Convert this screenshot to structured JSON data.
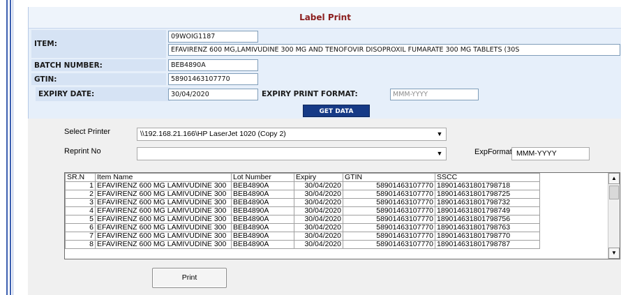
{
  "header": {
    "title": "Label Print"
  },
  "form": {
    "item_label": "ITEM:",
    "item_code": "09WOIG1187",
    "item_description": "EFAVIRENZ 600 MG,LAMIVUDINE 300 MG AND TENOFOVIR DISOPROXIL FUMARATE 300 MG TABLETS (30S",
    "batch_label": "BATCH NUMBER:",
    "batch_value": "BEB4890A",
    "gtin_label": "GTIN:",
    "gtin_value": "58901463107770",
    "expiry_label": "EXPIRY DATE:",
    "expiry_value": "30/04/2020",
    "expiry_format_label": "EXPIRY PRINT FORMAT:",
    "expiry_format_placeholder": "MMM-YYYY",
    "get_data_label": "GET DATA"
  },
  "printer": {
    "select_label": "Select Printer",
    "selected": "\\\\192.168.21.166\\HP LaserJet 1020 (Copy 2)",
    "reprint_label": "Reprint No",
    "reprint_value": "",
    "expformat_label": "ExpFormat",
    "expformat_value": "MMM-YYYY"
  },
  "grid": {
    "columns": [
      "SR.N",
      "Item Name",
      "Lot Number",
      "Expiry",
      "GTIN",
      "SSCC"
    ],
    "rows": [
      [
        "1",
        "EFAVIRENZ 600 MG LAMIVUDINE 300",
        "BEB4890A",
        "30/04/2020",
        "58901463107770",
        "189014631801798718"
      ],
      [
        "2",
        "EFAVIRENZ 600 MG LAMIVUDINE 300",
        "BEB4890A",
        "30/04/2020",
        "58901463107770",
        "189014631801798725"
      ],
      [
        "3",
        "EFAVIRENZ 600 MG LAMIVUDINE 300",
        "BEB4890A",
        "30/04/2020",
        "58901463107770",
        "189014631801798732"
      ],
      [
        "4",
        "EFAVIRENZ 600 MG LAMIVUDINE 300",
        "BEB4890A",
        "30/04/2020",
        "58901463107770",
        "189014631801798749"
      ],
      [
        "5",
        "EFAVIRENZ 600 MG LAMIVUDINE 300",
        "BEB4890A",
        "30/04/2020",
        "58901463107770",
        "189014631801798756"
      ],
      [
        "6",
        "EFAVIRENZ 600 MG LAMIVUDINE 300",
        "BEB4890A",
        "30/04/2020",
        "58901463107770",
        "189014631801798763"
      ],
      [
        "7",
        "EFAVIRENZ 600 MG LAMIVUDINE 300",
        "BEB4890A",
        "30/04/2020",
        "58901463107770",
        "189014631801798770"
      ],
      [
        "8",
        "EFAVIRENZ 600 MG LAMIVUDINE 300",
        "BEB4890A",
        "30/04/2020",
        "58901463107770",
        "189014631801798787"
      ]
    ]
  },
  "actions": {
    "print_label": "Print"
  },
  "icons": {
    "dropdown": "chevron-down-icon",
    "scroll_up": "scroll-up-icon",
    "scroll_down": "scroll-down-icon"
  },
  "colors": {
    "title": "#8b1d1d",
    "panel": "#e6effa",
    "label_row": "#d6e3f4",
    "get_data_button": "#163a86",
    "rail": "#3b5fb0"
  }
}
